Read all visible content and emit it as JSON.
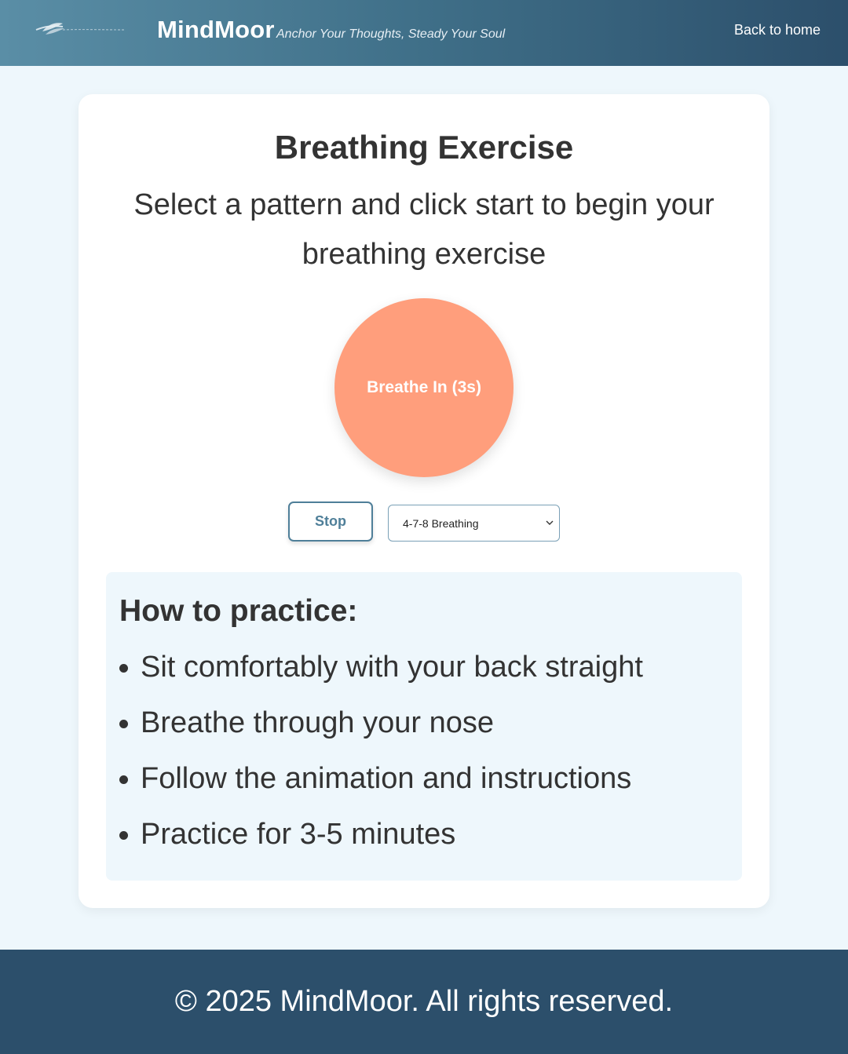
{
  "header": {
    "brand": "MindMoor",
    "tagline": "Anchor Your Thoughts, Steady Your Soul",
    "back_link": "Back to home",
    "logo_icon": "feather-logo-icon",
    "gradient_colors": [
      "#5a8ea6",
      "#2c4f6b"
    ]
  },
  "exercise": {
    "title": "Breathing Exercise",
    "subtitle": "Select a pattern and click start to begin your breathing exercise",
    "circle_label": "Breathe In (3s)",
    "circle_color": "#ff9e7c",
    "stop_label": "Stop",
    "pattern_selected": "4-7-8 Breathing",
    "select_icon": "chevron-down-icon"
  },
  "practice": {
    "heading": "How to practice:",
    "items": [
      "Sit comfortably with your back straight",
      "Breathe through your nose",
      "Follow the animation and instructions",
      "Practice for 3-5 minutes"
    ],
    "background_color": "#eef7fc"
  },
  "footer": {
    "text": "© 2025 MindMoor. All rights reserved.",
    "background_color": "#2c4f6b"
  }
}
